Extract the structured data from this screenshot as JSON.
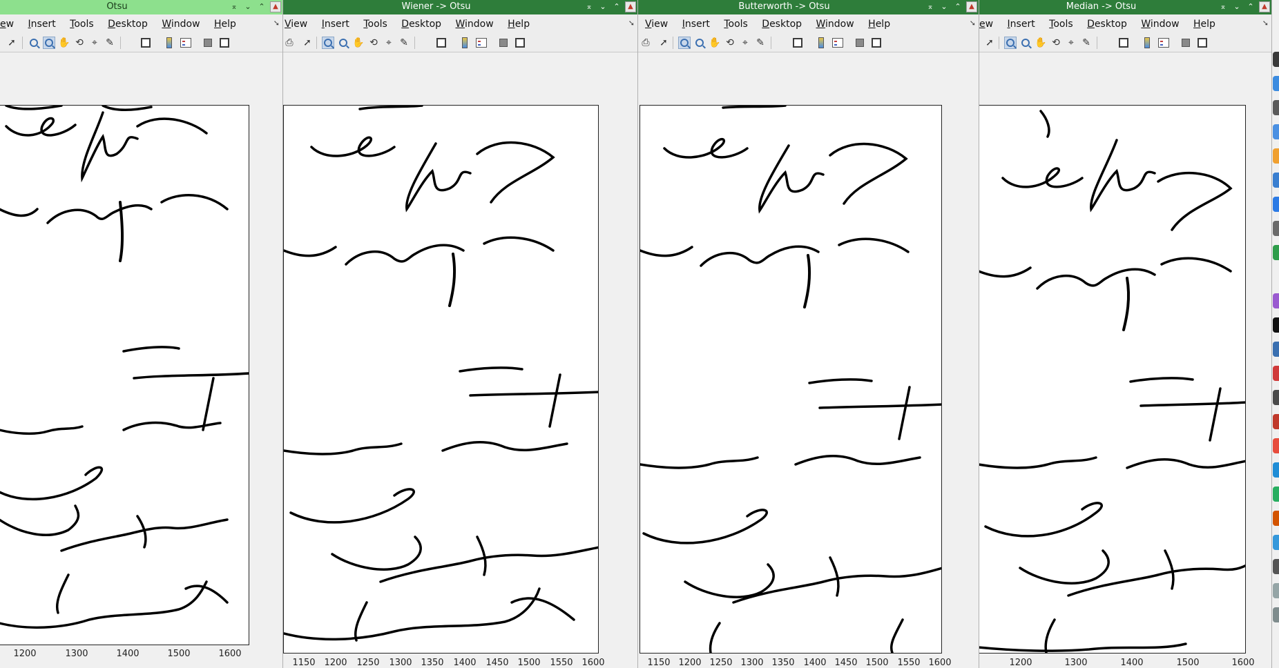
{
  "menus": {
    "otsu": [
      "ew",
      "Insert",
      "Tools",
      "Desktop",
      "Window",
      "Help"
    ],
    "full": [
      "View",
      "Insert",
      "Tools",
      "Desktop",
      "Window",
      "Help"
    ]
  },
  "windows": [
    {
      "title": "Otsu",
      "active": true,
      "xticks": [
        "1200",
        "1300",
        "1400",
        "1500",
        "1600"
      ]
    },
    {
      "title": "Wiener -> Otsu",
      "active": false,
      "xticks": [
        "1150",
        "1200",
        "1250",
        "1300",
        "1350",
        "1400",
        "1450",
        "1500",
        "1550",
        "1600"
      ]
    },
    {
      "title": "Butterworth -> Otsu",
      "active": false,
      "xticks": [
        "1150",
        "1200",
        "1250",
        "1300",
        "1350",
        "1400",
        "1450",
        "1500",
        "1550",
        "1600"
      ]
    },
    {
      "title": "Median -> Otsu",
      "active": false,
      "xticks": [
        "1200",
        "1300",
        "1400",
        "1500",
        "1600"
      ]
    }
  ],
  "icons": {
    "titlebar": [
      "keep-above-icon",
      "minimize-icon",
      "maximize-icon",
      "close-icon"
    ],
    "toolbar": [
      "print-icon",
      "pointer-icon",
      "zoom-in-icon",
      "zoom-out-icon",
      "pan-hand-icon",
      "rotate-3d-icon",
      "data-cursor-icon",
      "brush-icon",
      "link-plot-icon",
      "colorbar-icon",
      "legend-icon",
      "hide-plot-tools-icon",
      "show-plot-tools-icon"
    ]
  },
  "colors": {
    "active_title": "#8de08d",
    "inactive_title": "#2e7d3a",
    "ink": "#000000"
  }
}
